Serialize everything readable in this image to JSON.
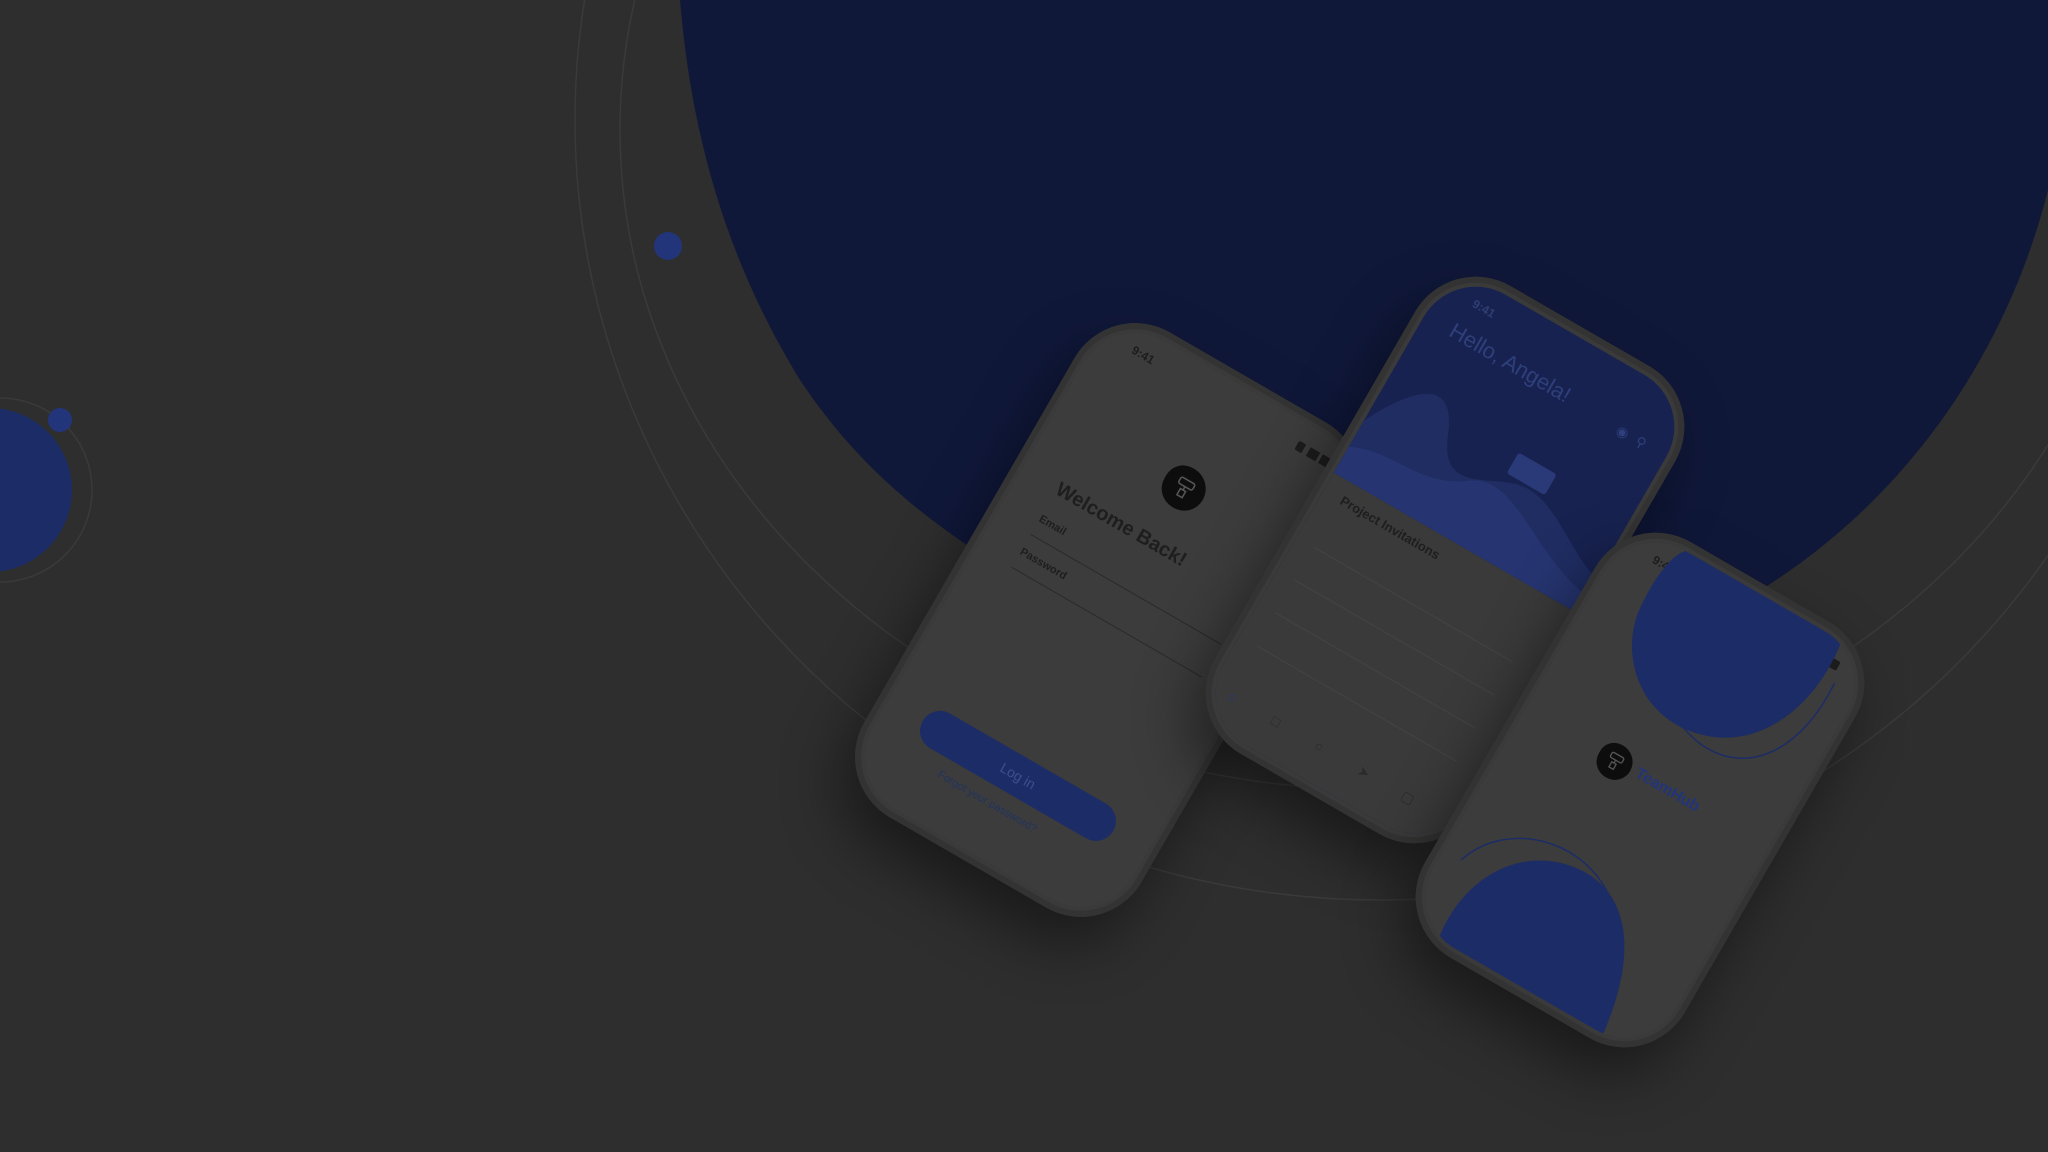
{
  "colors": {
    "background": "#2e2e2e",
    "accent_blue": "#10183a",
    "button_blue": "#1c2c66",
    "dot_blue": "#23357a",
    "dot_yellow": "#a8860d",
    "phone_body": "#3a3a3a"
  },
  "login_phone": {
    "status_time": "9:41",
    "title": "Welcome Back!",
    "email_label": "Email",
    "password_label": "Password",
    "login_button": "Log in",
    "forgot_link": "Forgot your password?"
  },
  "dashboard_phone": {
    "status_time": "9:41",
    "greeting": "Hello, Angela!",
    "section_title": "Project Invitations",
    "bell_icon": "bell-icon",
    "search_icon": "search-icon"
  },
  "splash_phone": {
    "status_time": "9:41",
    "brand": "TeamHub"
  }
}
